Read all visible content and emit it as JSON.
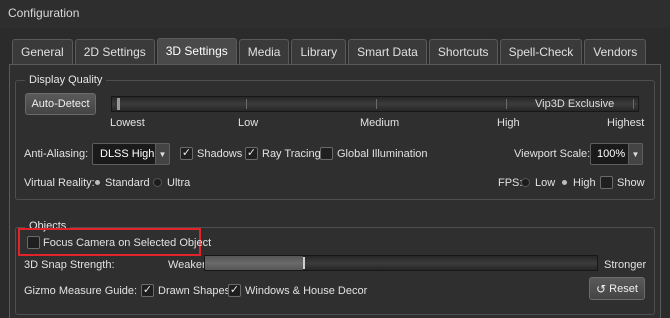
{
  "window": {
    "title": "Configuration"
  },
  "tabs": [
    "General",
    "2D Settings",
    "3D Settings",
    "Media",
    "Library",
    "Smart Data",
    "Shortcuts",
    "Spell-Check",
    "Vendors"
  ],
  "active_tab": "3D Settings",
  "display_quality": {
    "title": "Display Quality",
    "auto_detect_label": "Auto-Detect",
    "slider_text": "Vip3D Exclusive",
    "quality_levels": [
      "Lowest",
      "Low",
      "Medium",
      "High",
      "Highest"
    ],
    "anti_aliasing": {
      "label": "Anti-Aliasing:",
      "value": "DLSS High"
    },
    "shadows": {
      "label": "Shadows",
      "checked": true
    },
    "ray_tracing": {
      "label": "Ray Tracing",
      "checked": true
    },
    "global_illumination": {
      "label": "Global Illumination",
      "checked": false
    },
    "viewport_scale": {
      "label": "Viewport Scale:",
      "value": "100%"
    },
    "virtual_reality": {
      "label": "Virtual Reality:",
      "options": [
        "Standard",
        "Ultra"
      ],
      "selected": "Standard"
    },
    "fps": {
      "label": "FPS:",
      "options": [
        "Low",
        "High"
      ],
      "selected": "High",
      "show_label": "Show",
      "show_checked": false
    }
  },
  "objects": {
    "title": "Objects",
    "focus_camera": {
      "label": "Focus Camera on Selected Object",
      "checked": false
    },
    "snap_strength": {
      "label": "3D Snap Strength:",
      "min_label": "Weaker",
      "max_label": "Stronger",
      "level": 0.25
    },
    "gizmo_guide": {
      "label": "Gizmo Measure Guide:"
    },
    "drawn_shapes": {
      "label": "Drawn Shapes",
      "checked": true
    },
    "windows_house_decor": {
      "label": "Windows & House Decor",
      "checked": true
    },
    "reset_label": "Reset"
  },
  "colors": {
    "highlight": "#e0242a"
  }
}
